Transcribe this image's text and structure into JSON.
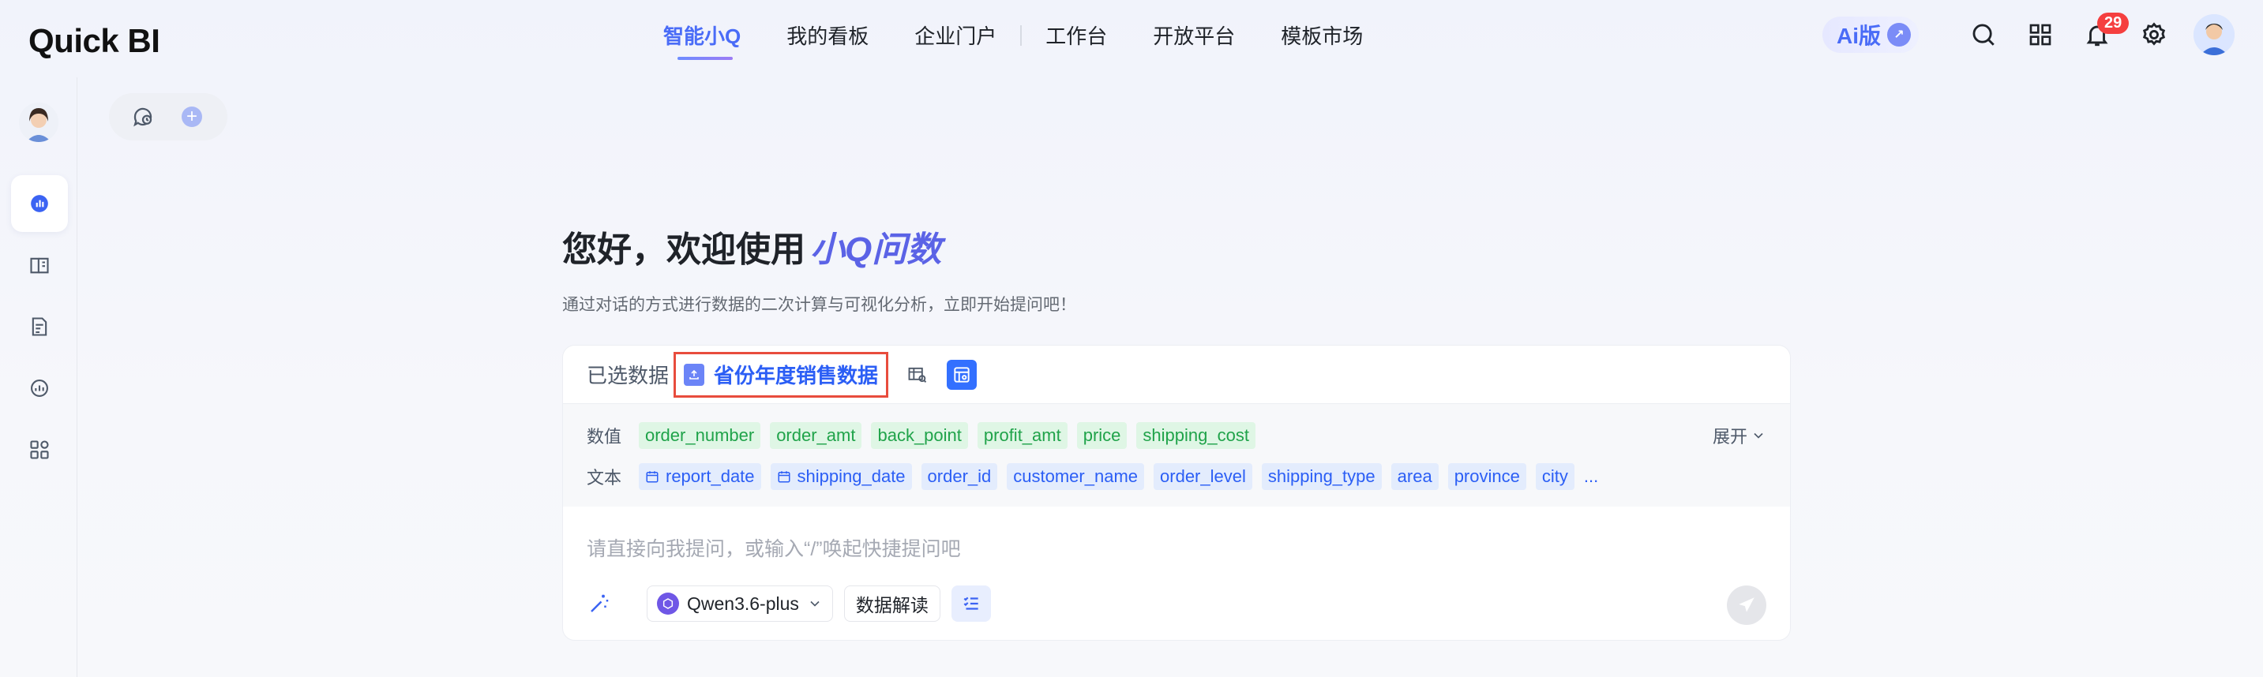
{
  "app": {
    "logo_text_pre": "Q",
    "logo_text_post": "uick BI"
  },
  "nav": {
    "items": [
      {
        "label": "智能小Q",
        "active": true
      },
      {
        "label": "我的看板"
      },
      {
        "label": "企业门户"
      },
      {
        "label": "工作台"
      },
      {
        "label": "开放平台"
      },
      {
        "label": "模板市场"
      }
    ]
  },
  "header_tools": {
    "ai_badge": "Ai版",
    "notification_count": "29",
    "icons": [
      "search-icon",
      "grid-icon",
      "bell-icon",
      "gear-icon"
    ]
  },
  "sidebar": {
    "icons": [
      "chat-icon",
      "book-icon",
      "report-icon",
      "analysis-icon",
      "apps-icon"
    ]
  },
  "hero": {
    "greeting": "您好，欢迎使用",
    "brand": "小Q问数",
    "subtitle": "通过对话的方式进行数据的二次计算与可视化分析，立即开始提问吧！"
  },
  "dataset": {
    "selected_label": "已选数据",
    "name": "省份年度销售数据"
  },
  "fields": {
    "numeric_label": "数值",
    "numeric": [
      "order_number",
      "order_amt",
      "back_point",
      "profit_amt",
      "price",
      "shipping_cost"
    ],
    "text_label": "文本",
    "text": [
      {
        "name": "report_date",
        "date": true
      },
      {
        "name": "shipping_date",
        "date": true
      },
      {
        "name": "order_id"
      },
      {
        "name": "customer_name"
      },
      {
        "name": "order_level"
      },
      {
        "name": "shipping_type"
      },
      {
        "name": "area"
      },
      {
        "name": "province"
      },
      {
        "name": "city"
      }
    ],
    "more": "...",
    "expand_label": "展开"
  },
  "input": {
    "placeholder": "请直接向我提问，或输入“/”唤起快捷提问吧",
    "model": "Qwen3.6-plus",
    "interpret_label": "数据解读"
  },
  "colors": {
    "accent": "#2b5ef5",
    "numeric_tag_bg": "#dff6e5",
    "numeric_tag_fg": "#20a34a",
    "text_tag_bg": "#e3ecfd",
    "highlight_border": "#e84c3d"
  }
}
